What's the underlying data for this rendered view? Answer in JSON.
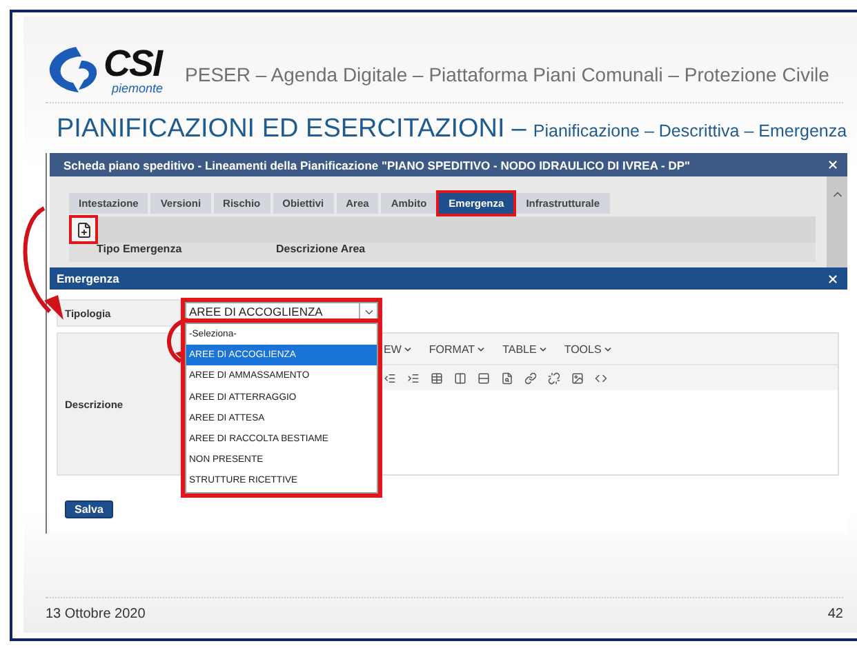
{
  "header": {
    "logo_text": "CSI",
    "logo_subtext": "piemonte",
    "title": "PESER – Agenda Digitale – Piattaforma Piani Comunali – Protezione Civile"
  },
  "page_title": {
    "main": "PIANIFICAZIONI ED ESERCITAZIONI",
    "separator": "–",
    "subtitle": "Pianificazione – Descrittiva – Emergenza"
  },
  "window": {
    "title": "Scheda piano speditivo - Lineamenti della Pianificazione \"PIANO SPEDITIVO - NODO IDRAULICO DI IVREA - DP\""
  },
  "tabs": [
    {
      "label": "Intestazione",
      "selected": false
    },
    {
      "label": "Versioni",
      "selected": false
    },
    {
      "label": "Rischio",
      "selected": false
    },
    {
      "label": "Obiettivi",
      "selected": false
    },
    {
      "label": "Area",
      "selected": false
    },
    {
      "label": "Ambito",
      "selected": false
    },
    {
      "label": "Emergenza",
      "selected": true
    },
    {
      "label": "Infrastrutturale",
      "selected": false
    }
  ],
  "toolbar": {
    "highlighted": true
  },
  "table": {
    "columns": [
      "Tipo Emergenza",
      "Descrizione Area"
    ]
  },
  "dialog": {
    "title": "Emergenza",
    "tipologia": {
      "label": "Tipologia",
      "value": "AREE DI ACCOGLIENZA",
      "expanded": true,
      "highlighted": true
    },
    "options": [
      {
        "label": "-Seleziona-",
        "selected": false
      },
      {
        "label": "AREE DI ACCOGLIENZA",
        "selected": true
      },
      {
        "label": "AREE DI AMMASSAMENTO",
        "selected": false
      },
      {
        "label": "AREE DI ATTERRAGGIO",
        "selected": false
      },
      {
        "label": "AREE DI ATTESA",
        "selected": false
      },
      {
        "label": "AREE DI RACCOLTA BESTIAME",
        "selected": false
      },
      {
        "label": "NON PRESENTE",
        "selected": false
      },
      {
        "label": "STRUTTURE RICETTIVE",
        "selected": false
      }
    ],
    "descrizione": {
      "label": "Descrizione",
      "menus": [
        "EW",
        "FORMAT",
        "TABLE",
        "TOOLS"
      ]
    },
    "save_button": "Salva"
  },
  "footer": {
    "date": "13 Ottobre 2020",
    "page": "42"
  }
}
